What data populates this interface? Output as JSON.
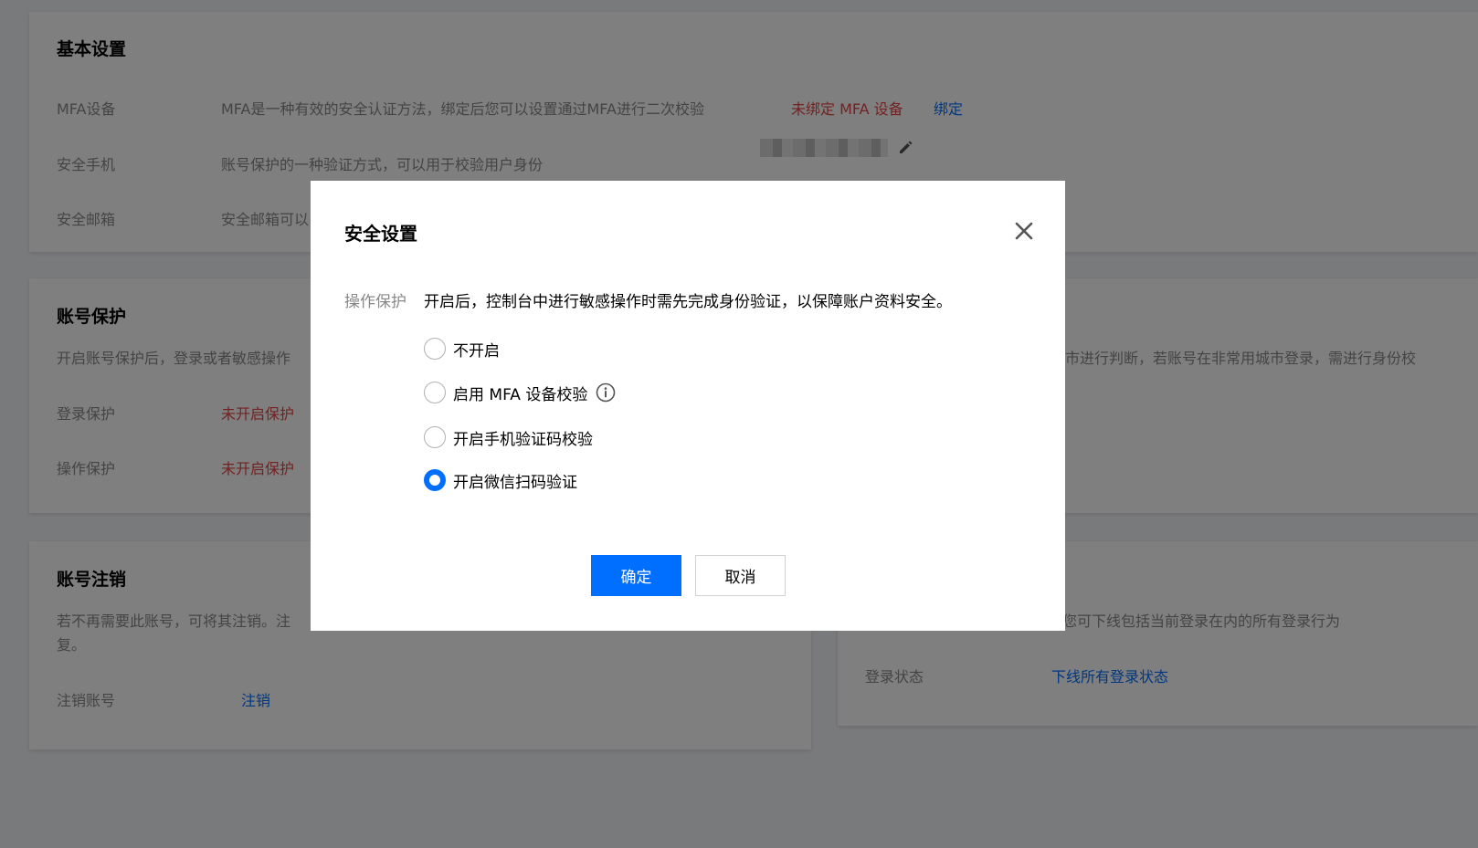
{
  "basic": {
    "title": "基本设置",
    "mfa": {
      "label": "MFA设备",
      "desc": "MFA是一种有效的安全认证方法，绑定后您可以设置通过MFA进行二次校验",
      "status": "未绑定 MFA 设备",
      "action": "绑定"
    },
    "phone": {
      "label": "安全手机",
      "desc": "账号保护的一种验证方式，可以用于校验用户身份"
    },
    "email": {
      "label": "安全邮箱",
      "desc": "安全邮箱可以"
    }
  },
  "protection": {
    "title": "账号保护",
    "desc": "开启账号保护后，登录或者敏感操作",
    "login": {
      "label": "登录保护",
      "status": "未开启保护"
    },
    "operation": {
      "label": "操作保护",
      "status": "未开启保护"
    }
  },
  "right_card": {
    "desc": "录城市进行判断，若账号在非常用城市登录，需进行身份校"
  },
  "cancel": {
    "title": "账号注销",
    "desc_line1": "若不再需要此账号，可将其注销。注",
    "desc_line2": "复。",
    "row": {
      "label": "注销账号",
      "action": "注销"
    }
  },
  "sessions": {
    "desc": "您可下线包括当前登录在内的所有登录行为",
    "row": {
      "label": "登录状态",
      "action": "下线所有登录状态"
    }
  },
  "dialog": {
    "title": "安全设置",
    "field_label": "操作保护",
    "field_desc": "开启后，控制台中进行敏感操作时需先完成身份验证，以保障账户资料安全。",
    "options": [
      {
        "label": "不开启",
        "checked": false
      },
      {
        "label": "启用 MFA 设备校验",
        "checked": false,
        "info": "info-icon"
      },
      {
        "label": "开启手机验证码校验",
        "checked": false
      },
      {
        "label": "开启微信扫码验证",
        "checked": true
      }
    ],
    "confirm": "确定",
    "cancel": "取消"
  },
  "colors": {
    "primary": "#006eff",
    "danger": "#e54545",
    "muted": "#888888",
    "overlay": "rgba(0,0,0,0.5)"
  }
}
